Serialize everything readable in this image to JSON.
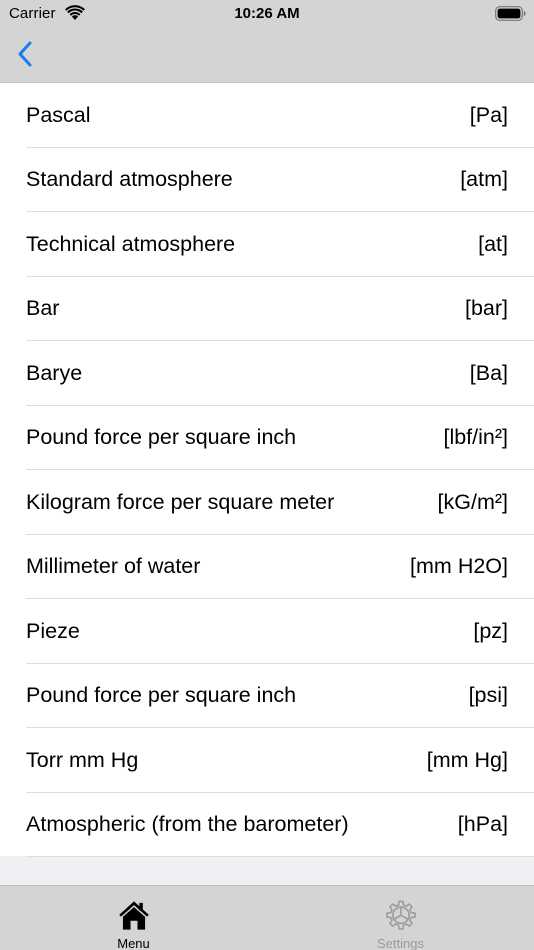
{
  "status_bar": {
    "carrier": "Carrier",
    "time": "10:26 AM"
  },
  "nav": {
    "back_icon": "chevron-left-icon",
    "accent_color": "#1a7cf2"
  },
  "units": [
    {
      "name": "Pascal",
      "unit": "[Pa]"
    },
    {
      "name": "Standard atmosphere",
      "unit": "[atm]"
    },
    {
      "name": "Technical atmosphere",
      "unit": "[at]"
    },
    {
      "name": "Bar",
      "unit": "[bar]"
    },
    {
      "name": "Barye",
      "unit": "[Ba]"
    },
    {
      "name": "Pound force per square inch",
      "unit": "[lbf/in²]"
    },
    {
      "name": "Kilogram force per square meter",
      "unit": "[kG/m²]"
    },
    {
      "name": "Millimeter of water",
      "unit": "[mm H2O]"
    },
    {
      "name": "Pieze",
      "unit": "[pz]"
    },
    {
      "name": "Pound force per square inch",
      "unit": "[psi]"
    },
    {
      "name": "Torr mm Hg",
      "unit": "[mm Hg]"
    },
    {
      "name": "Atmospheric (from the barometer)",
      "unit": "[hPa]"
    }
  ],
  "tab_bar": {
    "menu": {
      "label": "Menu",
      "icon": "home-icon",
      "selected": true
    },
    "settings": {
      "label": "Settings",
      "icon": "gear-icon",
      "selected": false
    }
  }
}
